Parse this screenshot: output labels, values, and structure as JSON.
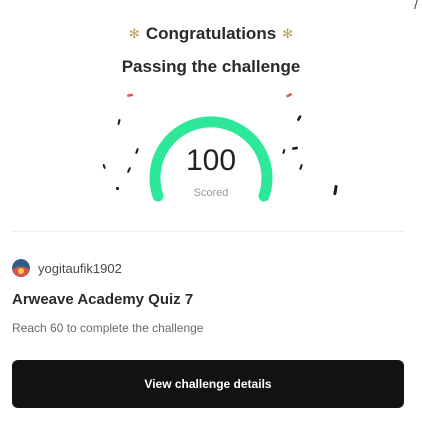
{
  "header": {
    "title": "Congratulations",
    "subtitle": "Passing the challenge"
  },
  "result": {
    "score": "100",
    "score_label": "Scored",
    "progress_fraction": 1.0
  },
  "user": {
    "username": "yogitaufik1902"
  },
  "quiz": {
    "title": "Arweave Academy Quiz 7",
    "description": "Reach 60 to complete the challenge"
  },
  "actions": {
    "view_details_label": "View challenge details"
  },
  "colors": {
    "gauge": "#2ee89a",
    "confetti": "#1c1c1c",
    "confetti_red": "#e25252",
    "button_bg": "#121212"
  },
  "icons": {
    "title_left": "party-popper-icon",
    "title_right": "party-popper-icon"
  }
}
